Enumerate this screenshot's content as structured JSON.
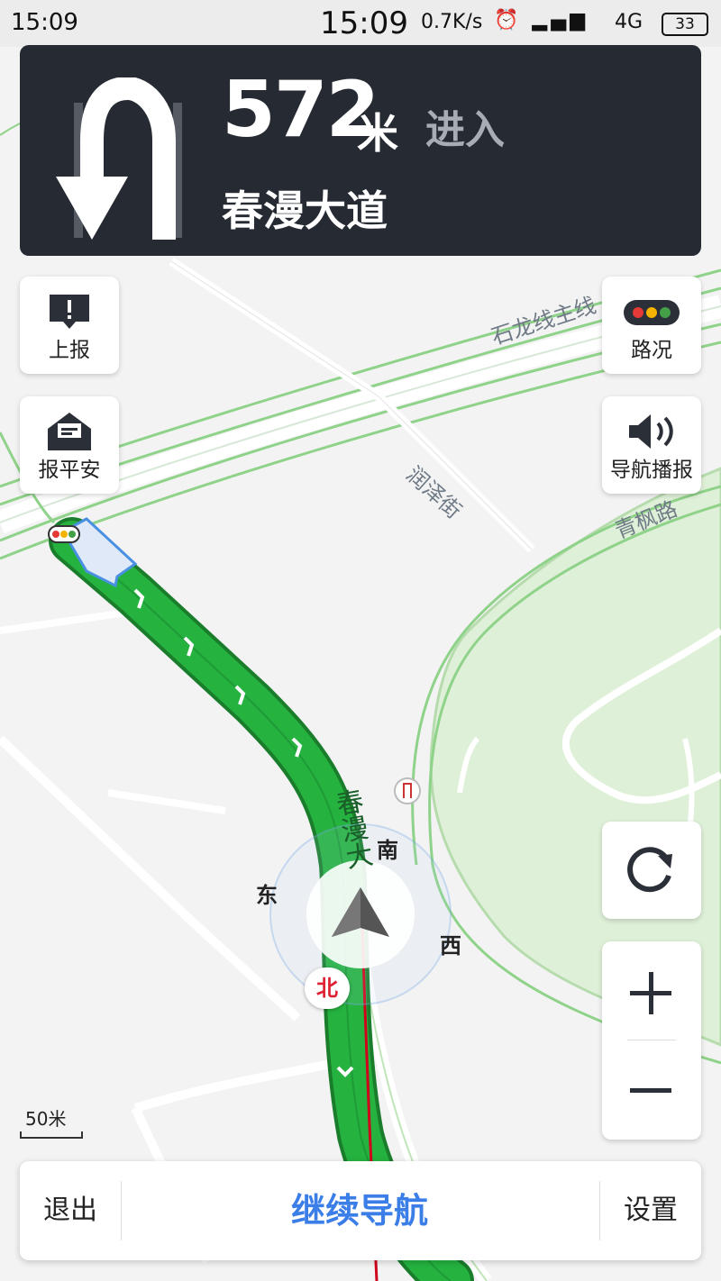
{
  "status_bar": {
    "time_left": "15:09",
    "time_center": "15:09",
    "net_speed": "0.7K/s",
    "network": "4G",
    "battery": "33"
  },
  "guidance": {
    "distance": "572",
    "unit": "米",
    "action": "进入",
    "road": "春漫大道",
    "turn_icon": "u-turn-left-icon"
  },
  "left_buttons": {
    "report": "上报",
    "safe": "报平安"
  },
  "right_buttons": {
    "traffic": "路况",
    "voice": "导航播报"
  },
  "map": {
    "roads": {
      "shilong": "石龙线主线",
      "runze": "润泽街",
      "qingfeng": "青枫路",
      "chunman": "春漫大"
    },
    "compass": {
      "south": "南",
      "east": "东",
      "west": "西",
      "north": "北"
    },
    "scale": "50米"
  },
  "bottom_bar": {
    "exit": "退出",
    "continue": "继续导航",
    "settings": "设置"
  },
  "colors": {
    "route": "#1fa83a",
    "guide_bg": "#262b33",
    "accent": "#3b7ee8",
    "track": "#d0021b"
  }
}
